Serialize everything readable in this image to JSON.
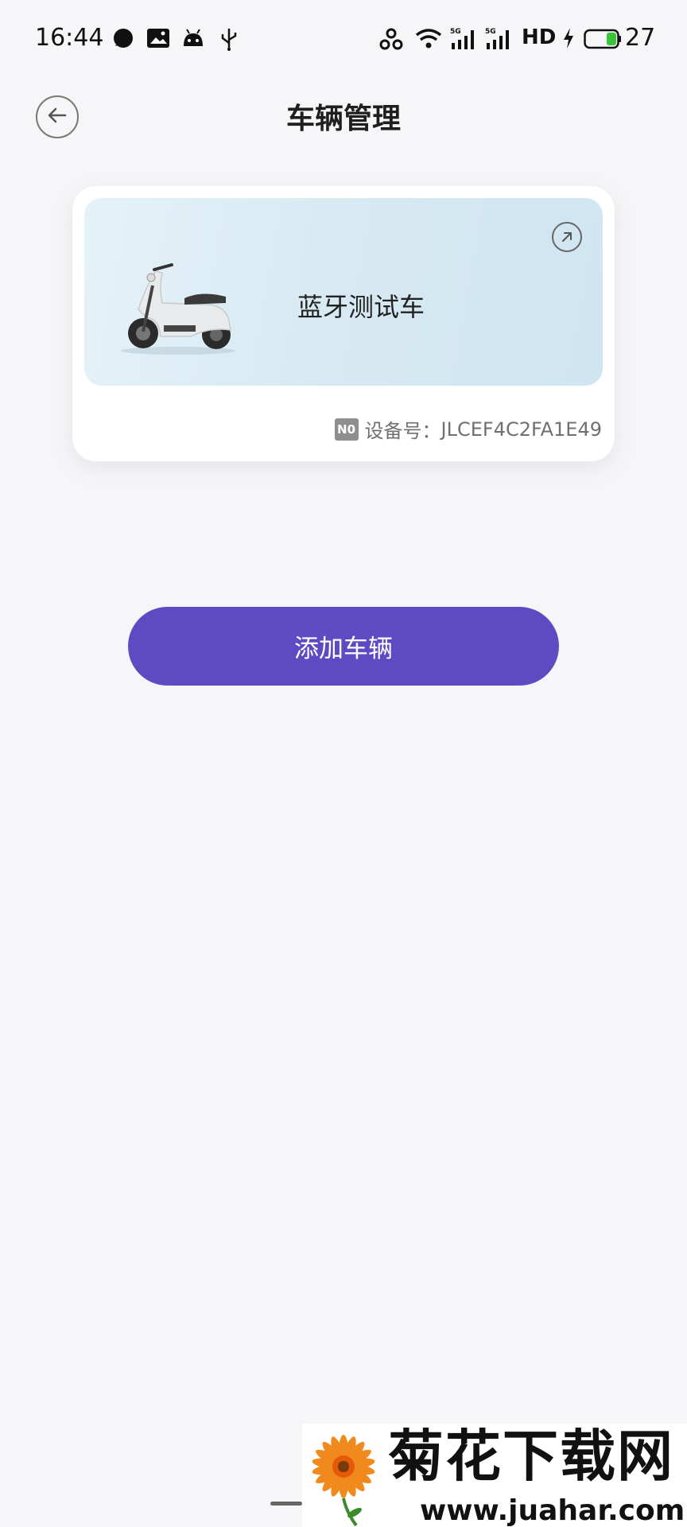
{
  "status_bar": {
    "time": "16:44",
    "network_hd": "HD",
    "battery_level": "27",
    "icons": [
      "message-icon",
      "gallery-icon",
      "android-icon",
      "usb-icon",
      "hotspot-icon",
      "wifi-icon",
      "signal-5g-icon",
      "signal-5g-icon",
      "charging-icon",
      "battery-icon"
    ]
  },
  "header": {
    "title": "车辆管理",
    "back_icon": "arrow-left-icon"
  },
  "vehicle": {
    "name": "蓝牙测试车",
    "device_label": "设备号：",
    "device_id": "JLCEF4C2FA1E49",
    "device_icon_text": "N0",
    "open_icon": "arrow-up-right-icon"
  },
  "actions": {
    "add_vehicle": "添加车辆"
  },
  "watermark": {
    "title": "菊花下载网",
    "url": "www.juahar.com"
  },
  "colors": {
    "background": "#f6f6f8",
    "primary": "#5e4bc4",
    "banner": "#d7e9f2"
  }
}
